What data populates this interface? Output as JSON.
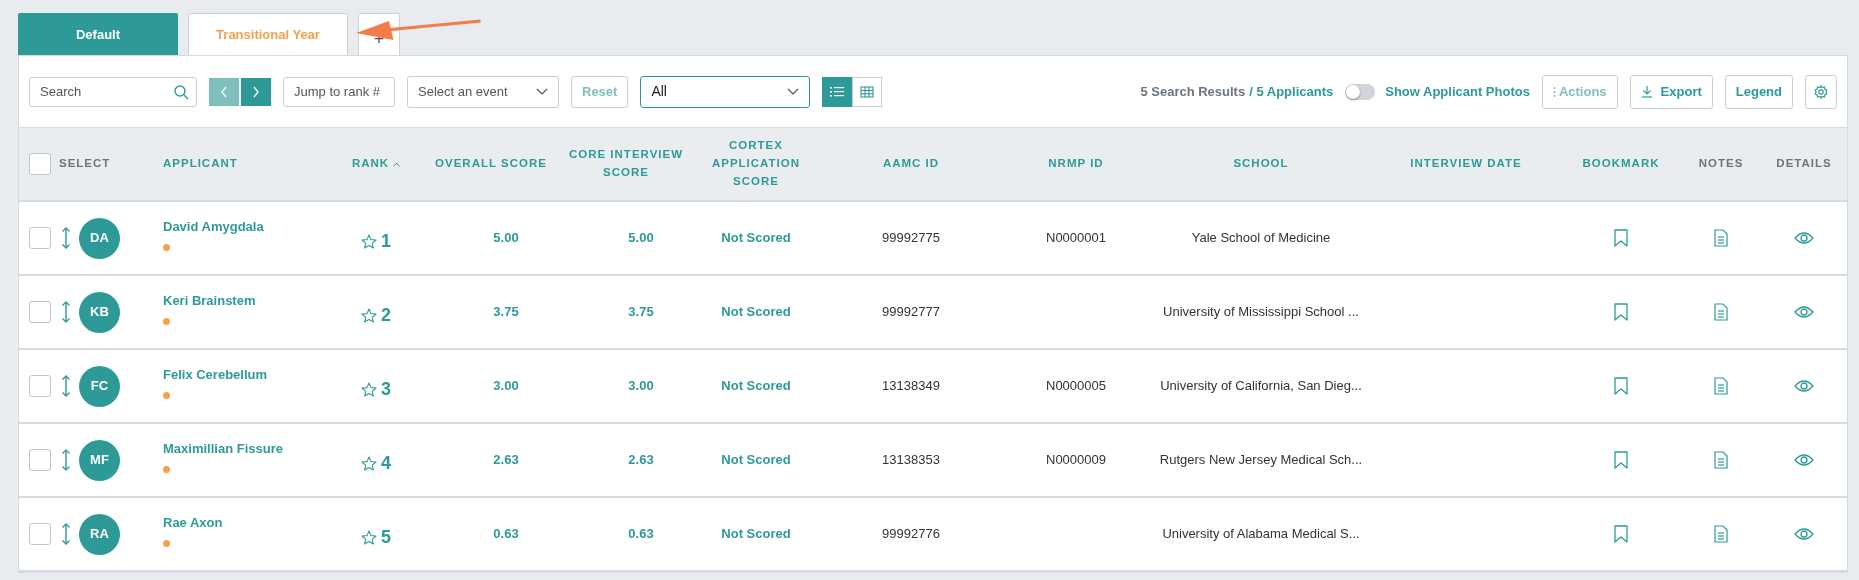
{
  "tabs": [
    {
      "label": "Default",
      "selected": true
    },
    {
      "label": "Transitional Year",
      "selected": false
    },
    {
      "label": "+",
      "selected": false
    }
  ],
  "toolbar": {
    "search": {
      "placeholder": "Search"
    },
    "pager": [
      {
        "kind": "prev",
        "disabled": true
      },
      {
        "kind": "next",
        "disabled": false
      }
    ],
    "jump": {
      "placeholder": "Jump to rank #"
    },
    "event_select": {
      "placeholder": "Select an event"
    },
    "reset": {
      "label": "Reset",
      "disabled": true
    },
    "filter_select": {
      "value": "All"
    },
    "views": [
      {
        "kind": "list",
        "selected": true
      },
      {
        "kind": "grid",
        "selected": false
      }
    ],
    "results": "5 Search Results",
    "applicants": "/ 5 Applicants",
    "photos_toggle": {
      "on": false,
      "label": "Show Applicant Photos"
    },
    "buttons": [
      {
        "kind": "actions",
        "label": "Actions",
        "disabled": true
      },
      {
        "kind": "export",
        "label": "Export",
        "disabled": false
      },
      {
        "kind": "legend",
        "label": "Legend",
        "disabled": false
      },
      {
        "kind": "settings",
        "disabled": false
      }
    ]
  },
  "table": {
    "select_all": {
      "checked": false
    },
    "columns": [
      {
        "label": "SELECT",
        "sortable": false,
        "sorted": false
      },
      {
        "label": "APPLICANT",
        "sortable": true,
        "sorted": false
      },
      {
        "label": "RANK",
        "sortable": true,
        "sorted": true
      },
      {
        "label": "OVERALL SCORE",
        "sortable": true,
        "sorted": false
      },
      {
        "label": "CORE INTERVIEW SCORE",
        "sortable": true,
        "sorted": false
      },
      {
        "label": "CORTEX APPLICATION SCORE",
        "sortable": true,
        "sorted": false
      },
      {
        "label": "AAMC ID",
        "sortable": true,
        "sorted": false
      },
      {
        "label": "NRMP ID",
        "sortable": true,
        "sorted": false
      },
      {
        "label": "SCHOOL",
        "sortable": true,
        "sorted": false
      },
      {
        "label": "INTERVIEW DATE",
        "sortable": true,
        "sorted": false
      },
      {
        "label": "BOOKMARK",
        "sortable": true,
        "sorted": false
      },
      {
        "label": "NOTES",
        "sortable": false,
        "sorted": false
      },
      {
        "label": "DETAILS",
        "sortable": false,
        "sorted": false
      }
    ],
    "rows": [
      {
        "selected": false,
        "initials": "DA",
        "name": "David Amygdala",
        "color": "#f7a04b",
        "starred": false,
        "rank": "1",
        "overall": "5.00",
        "core": "5.00",
        "cortex": "Not Scored",
        "aamc": "99992775",
        "nrmp": "N0000001",
        "school": "Yale School of Medicine",
        "bookmarked": false
      },
      {
        "selected": false,
        "initials": "KB",
        "name": "Keri Brainstem",
        "color": "#f7a04b",
        "starred": false,
        "rank": "2",
        "overall": "3.75",
        "core": "3.75",
        "cortex": "Not Scored",
        "aamc": "99992777",
        "school": "University of Mississippi School ...",
        "bookmarked": false
      },
      {
        "selected": false,
        "initials": "FC",
        "name": "Felix Cerebellum",
        "color": "#f7a04b",
        "starred": false,
        "rank": "3",
        "overall": "3.00",
        "core": "3.00",
        "cortex": "Not Scored",
        "aamc": "13138349",
        "nrmp": "N0000005",
        "school": "University of California, San Dieg...",
        "bookmarked": false
      },
      {
        "selected": false,
        "initials": "MF",
        "name": "Maximillian Fissure",
        "color": "#f7a04b",
        "starred": false,
        "rank": "4",
        "overall": "2.63",
        "core": "2.63",
        "cortex": "Not Scored",
        "aamc": "13138353",
        "nrmp": "N0000009",
        "school": "Rutgers New Jersey Medical Sch...",
        "bookmarked": false
      },
      {
        "selected": false,
        "initials": "RA",
        "name": "Rae Axon",
        "color": "#f7a04b",
        "starred": false,
        "rank": "5",
        "overall": "0.63",
        "core": "0.63",
        "cortex": "Not Scored",
        "aamc": "99992776",
        "school": "University of Alabama Medical S...",
        "bookmarked": false
      }
    ]
  }
}
